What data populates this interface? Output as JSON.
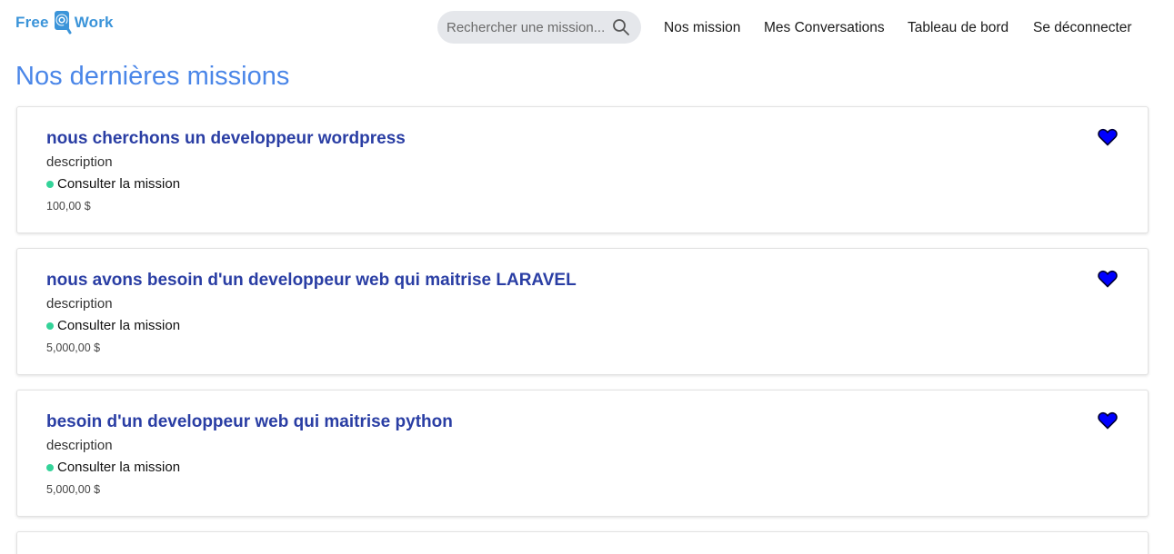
{
  "header": {
    "logo": {
      "left_text": "Free",
      "right_text": "Work"
    },
    "search": {
      "placeholder": "Rechercher une mission..."
    },
    "nav": [
      {
        "label": "Nos mission"
      },
      {
        "label": "Mes Conversations"
      },
      {
        "label": "Tableau de bord"
      },
      {
        "label": "Se déconnecter"
      }
    ]
  },
  "main": {
    "title": "Nos dernières missions",
    "missions": [
      {
        "title": "nous cherchons un developpeur wordpress",
        "description": "description",
        "link_label": "Consulter la mission",
        "price": "100,00 $"
      },
      {
        "title": "nous avons besoin d'un developpeur web qui maitrise LARAVEL",
        "description": "description",
        "link_label": "Consulter la mission",
        "price": "5,000,00 $"
      },
      {
        "title": "besoin d'un developpeur web qui maitrise python",
        "description": "description",
        "link_label": "Consulter la mission",
        "price": "5,000,00 $"
      }
    ]
  },
  "colors": {
    "brand": "#3b94d9",
    "title": "#4a86e8",
    "mission_title": "#2a3ea4",
    "status_dot": "#34d399",
    "heart": "#0000ff"
  },
  "icons": {
    "search": "search-icon",
    "favorite": "heart-icon",
    "logo": "magnifier-logo-icon"
  }
}
